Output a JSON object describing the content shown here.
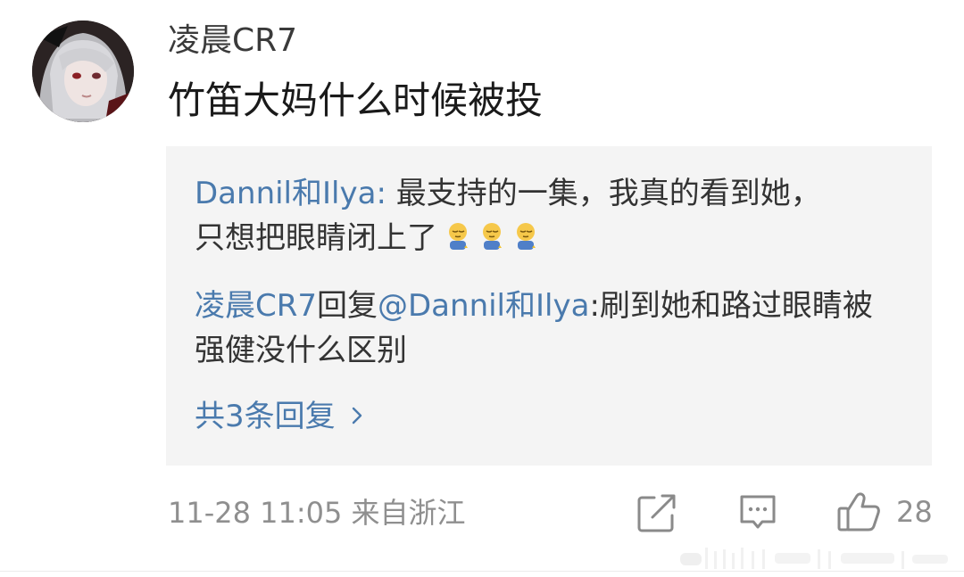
{
  "comment": {
    "username": "凌晨CR7",
    "text": "竹笛大妈什么时候被投",
    "timestamp": "11-28 11:05",
    "location": "来自浙江",
    "likes": "28",
    "avatar_icon": "avatar-doll-image"
  },
  "replies": [
    {
      "author": "Dannil和Ilya",
      "separator": ": ",
      "text": "最支持的一集，我真的看到她，只想把眼睛闭上了",
      "emojis": [
        "sleepy-face-emoji",
        "sleepy-face-emoji",
        "sleepy-face-emoji"
      ]
    },
    {
      "author": "凌晨CR7",
      "reply_word": "回复",
      "mention": "@Dannil和Ilya",
      "separator": ":",
      "text": "刷到她和路过眼睛被强健没什么区别"
    }
  ],
  "more_replies_label": "共3条回复",
  "actions": {
    "share_icon": "share-icon",
    "comment_icon": "comment-icon",
    "like_icon": "thumbs-up-icon"
  },
  "colors": {
    "link": "#4a7aad",
    "meta": "#8f8f8f",
    "reply_bg": "#f4f4f4"
  }
}
